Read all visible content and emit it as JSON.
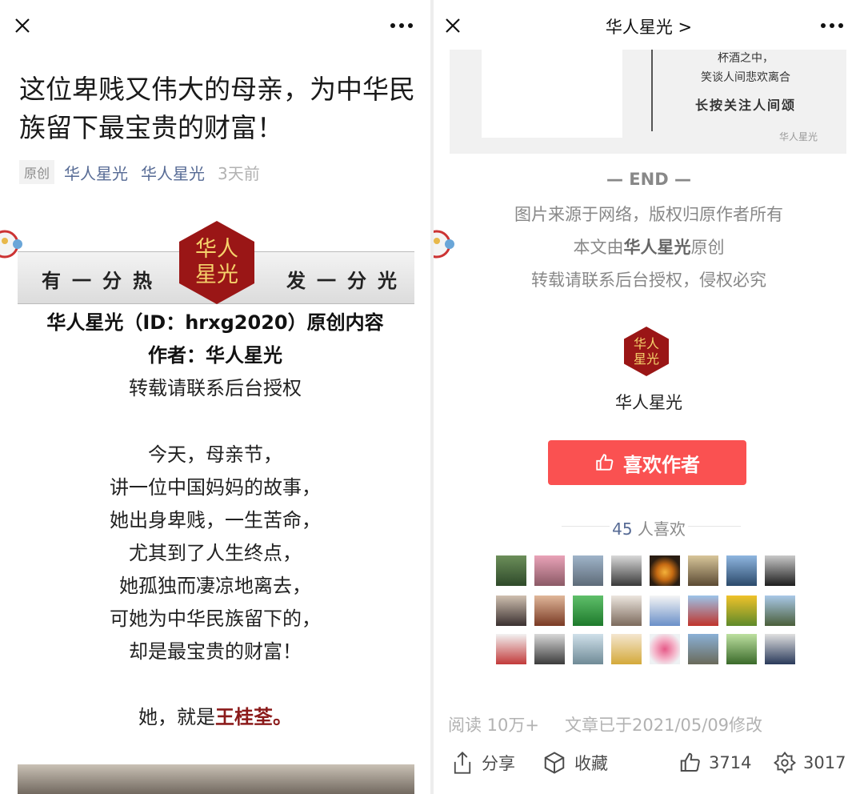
{
  "left": {
    "title": "这位卑贱又伟大的母亲，为中华民族留下最宝贵的财富！",
    "original_tag": "原创",
    "account1": "华人星光",
    "account2": "华人星光",
    "time_ago": "3天前",
    "banner_left": "有一分热",
    "banner_right": "发一分光",
    "logo_text": "华人星光",
    "intro_line1": "华人星光（ID：hrxg2020）原创内容",
    "intro_line2": "作者：华人星光",
    "intro_line3": "转载请联系后台授权",
    "poem": [
      "今天，母亲节，",
      "讲一位中国妈妈的故事，",
      "她出身卑贱，一生苦命，",
      "尤其到了人生终点，",
      "她孤独而凄凉地离去，",
      "可她为中华民族留下的，",
      "却是最宝贵的财富！"
    ],
    "final_prefix": "她，就是",
    "final_name": "王桂荃。"
  },
  "right": {
    "header_title": "华人星光 >",
    "img_line1": "杯酒之中，",
    "img_line2": "笑谈人间悲欢离合",
    "img_line3": "长按关注人间颂",
    "watermark": "华人星光",
    "end": "— END —",
    "footer_line1": "图片来源于网络，版权归原作者所有",
    "footer_line2_prefix": "本文由",
    "footer_line2_bold": "华人星光",
    "footer_line2_suffix": "原创",
    "footer_line3": "转载请联系后台授权，侵权必究",
    "author_logo_text": "华人星光",
    "author_name": "华人星光",
    "like_author_button": "喜欢作者",
    "likes_count": "45",
    "likes_suffix": "人喜欢",
    "read_label": "阅读 10万+",
    "modified": "文章已于2021/05/09修改",
    "share": "分享",
    "collect": "收藏",
    "thumbs": "3714",
    "wow": "3017"
  },
  "colors": {
    "accent_red": "#fa5151",
    "link_blue": "#576b95",
    "logo_red": "#9a1616",
    "name_red": "#8b1a1a"
  }
}
